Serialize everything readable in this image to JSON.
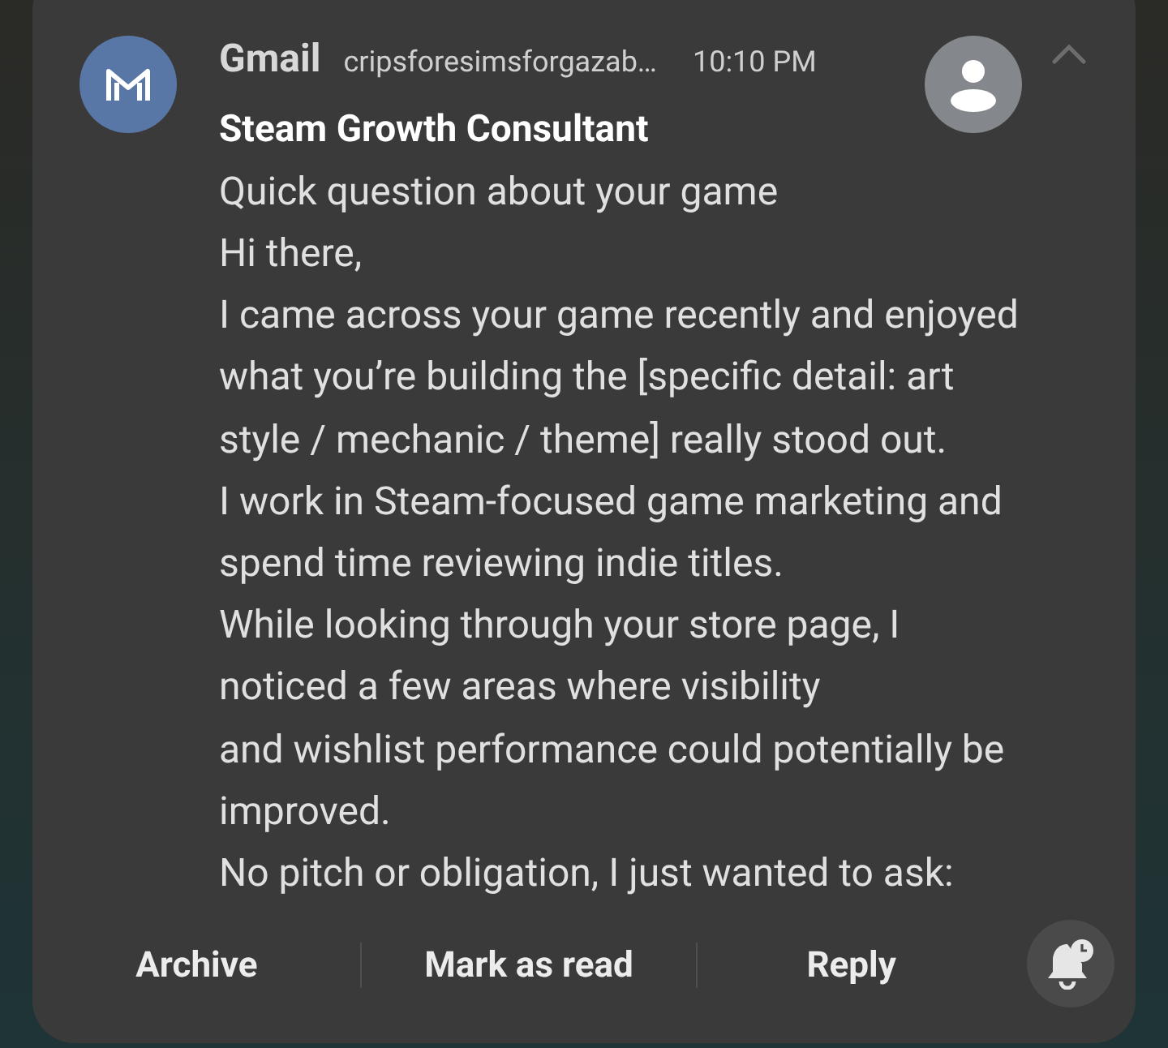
{
  "notification": {
    "app": "Gmail",
    "account": "cripsforesimsforgazab…",
    "time": "10:10 PM",
    "expanded": true,
    "sender": "Steam Growth Consultant",
    "subject": "Quick question about your game",
    "body_lines": [
      "Hi there,",
      "I came across your game recently and enjoyed",
      "what you’re building the [specific detail: art",
      "style / mechanic / theme] really stood out.",
      "I work in Steam-focused game marketing and",
      "spend time reviewing indie titles.",
      "While looking through your store page, I",
      "noticed a few areas where visibility",
      "and wishlist performance could potentially be",
      "improved.",
      "No pitch or obligation, I just wanted to ask:"
    ],
    "actions": [
      "Archive",
      "Mark as read",
      "Reply"
    ]
  }
}
